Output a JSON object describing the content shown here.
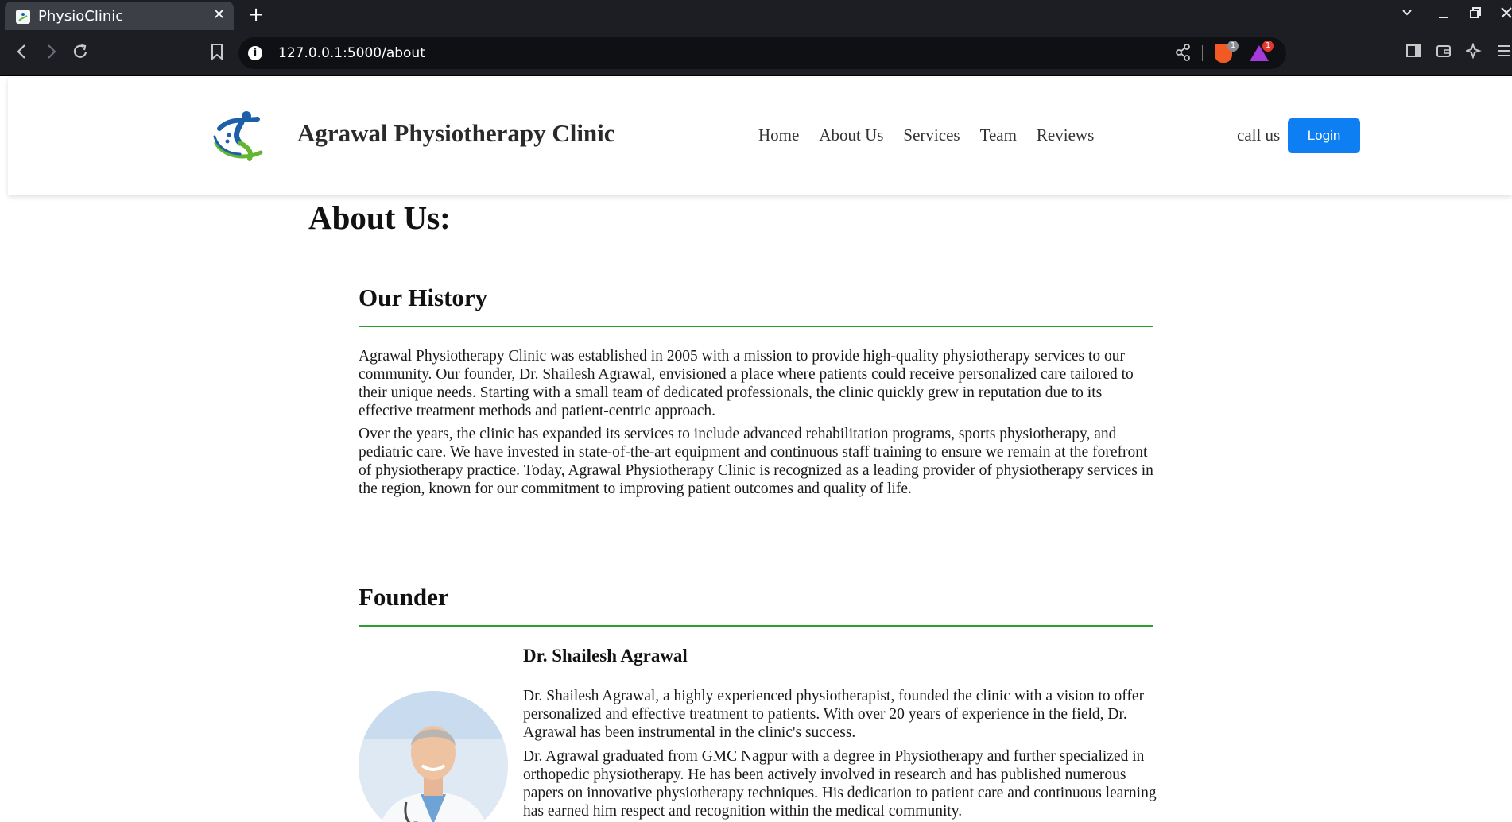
{
  "browser": {
    "tab_title": "PhysioClinic",
    "tab_close": "✕",
    "new_tab": "+",
    "url": "127.0.0.1:5000/about",
    "info_glyph": "i",
    "brave_badge_count": "1",
    "rewards_badge_count": "1",
    "icons": {
      "back": "back-arrow-icon",
      "forward": "forward-arrow-icon",
      "reload": "reload-icon",
      "bookmark": "bookmark-icon",
      "share": "share-icon",
      "sidebar": "sidebar-icon",
      "wallet": "wallet-icon",
      "leo": "leo-ai-icon",
      "menu": "menu-icon",
      "tab_search": "chevron-down-icon",
      "minimize": "minimize-icon",
      "restore": "restore-icon",
      "close": "close-icon"
    }
  },
  "header": {
    "brand": "Agrawal Physiotherapy Clinic",
    "nav": [
      "Home",
      "About Us",
      "Services",
      "Team",
      "Reviews"
    ],
    "call_us": "call us",
    "login": "Login"
  },
  "about": {
    "title": "About Us:",
    "history": {
      "heading": "Our History",
      "paragraphs": [
        "Agrawal Physiotherapy Clinic was established in 2005 with a mission to provide high-quality physiotherapy services to our community. Our founder, Dr. Shailesh Agrawal, envisioned a place where patients could receive personalized care tailored to their unique needs. Starting with a small team of dedicated professionals, the clinic quickly grew in reputation due to its effective treatment methods and patient-centric approach.",
        "Over the years, the clinic has expanded its services to include advanced rehabilitation programs, sports physiotherapy, and pediatric care. We have invested in state-of-the-art equipment and continuous staff training to ensure we remain at the forefront of physiotherapy practice. Today, Agrawal Physiotherapy Clinic is recognized as a leading provider of physiotherapy services in the region, known for our commitment to improving patient outcomes and quality of life."
      ]
    },
    "founder": {
      "heading": "Founder",
      "name": "Dr. Shailesh Agrawal",
      "paragraphs": [
        "Dr. Shailesh Agrawal, a highly experienced physiotherapist, founded the clinic with a vision to offer personalized and effective treatment to patients. With over 20 years of experience in the field, Dr. Agrawal has been instrumental in the clinic's success.",
        "Dr. Agrawal graduated from GMC Nagpur with a degree in Physiotherapy and further specialized in orthopedic physiotherapy. He has been actively involved in research and has published numerous papers on innovative physiotherapy techniques. His dedication to patient care and continuous learning has earned him respect and recognition within the medical community."
      ]
    }
  },
  "colors": {
    "accent_green": "#2ca02c",
    "login_blue": "#0d7ff3",
    "logo_blue": "#1d5fa8",
    "logo_green": "#64b631"
  }
}
